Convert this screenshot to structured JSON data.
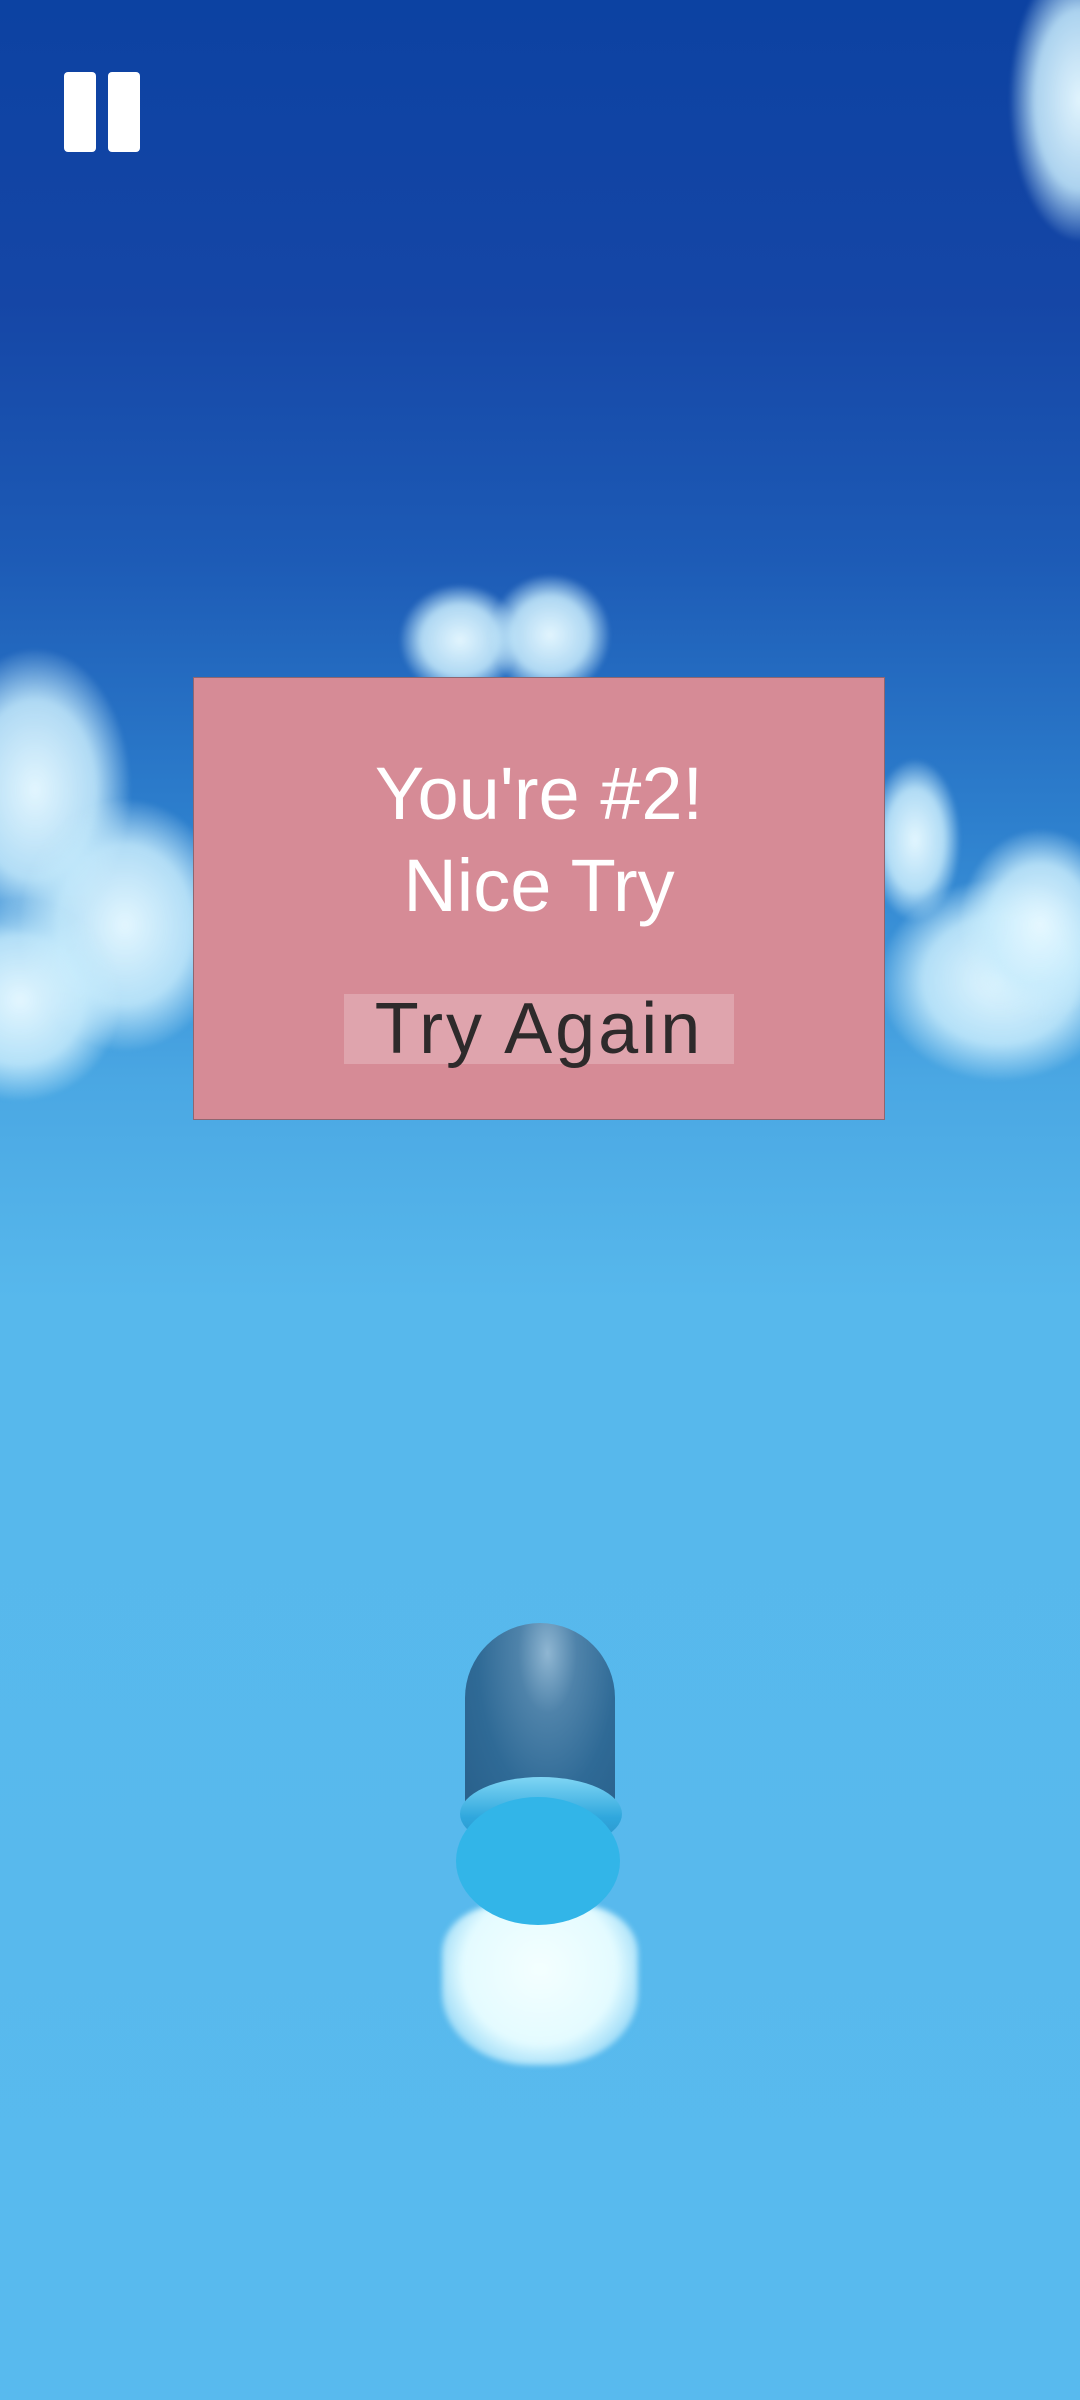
{
  "hud": {
    "pause_icon": "pause-icon"
  },
  "result_panel": {
    "line1": "You're #2!",
    "line2": "Nice Try",
    "button_label": "Try Again",
    "background": "#d68b96"
  },
  "colors": {
    "sky_top": "#0c42a2",
    "sky_bottom": "#58baee",
    "player_body": "#2f6a96",
    "player_disc": "#32b5e8"
  }
}
